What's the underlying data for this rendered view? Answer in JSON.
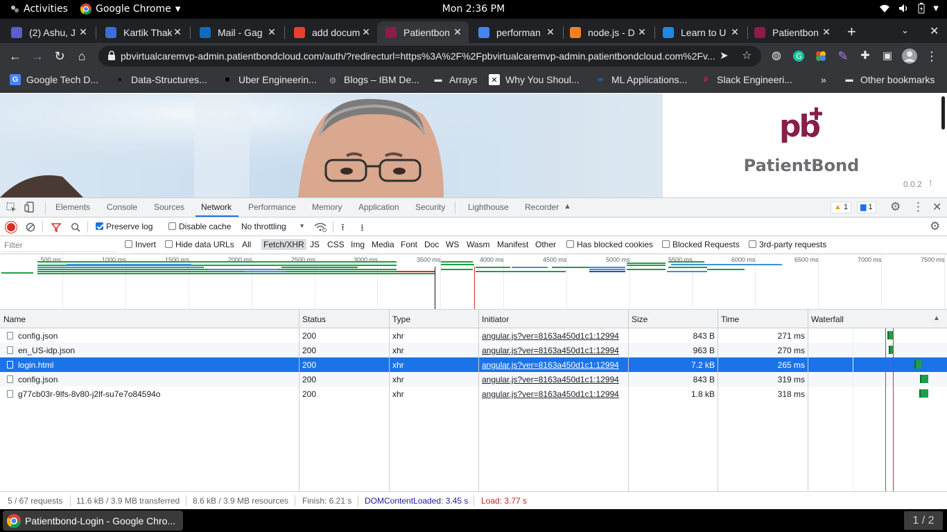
{
  "topbar": {
    "activities": "Activities",
    "app_name": "Google Chrome",
    "clock": "Mon  2:36 PM"
  },
  "tabs": [
    {
      "title": "(2) Ashu, J",
      "icon": "teams-icon",
      "color": "#5b5fc7"
    },
    {
      "title": "Kartik Thak",
      "icon": "app-icon",
      "color": "#3b6fd8"
    },
    {
      "title": "Mail - Gag",
      "icon": "outlook-icon",
      "color": "#0f6cbd"
    },
    {
      "title": "add docum",
      "icon": "gitlab-icon",
      "color": "#e24329"
    },
    {
      "title": "Patientbon",
      "icon": "pb-icon",
      "color": "#8a1d4a",
      "active": true
    },
    {
      "title": "performan",
      "icon": "google-icon",
      "color": "#4285f4"
    },
    {
      "title": "node.js - D",
      "icon": "stackoverflow-icon",
      "color": "#f48024"
    },
    {
      "title": "Learn to U",
      "icon": "app-icon",
      "color": "#1e88e5"
    },
    {
      "title": "Patientbon",
      "icon": "pb-icon",
      "color": "#8a1d4a"
    }
  ],
  "toolbar": {
    "url": "pbvirtualcaremvp-admin.patientbondcloud.com/auth/?redirecturl=https%3A%2F%2Fpbvirtualcaremvp-admin.patientbondcloud.com%2Fv..."
  },
  "bookmarks": [
    {
      "label": "Google Tech D...",
      "icon": "google-icon"
    },
    {
      "label": "Data-Structures...",
      "icon": "github-icon"
    },
    {
      "label": "Uber Engineerin...",
      "icon": "uber-icon"
    },
    {
      "label": "Blogs – IBM De...",
      "icon": "globe-icon"
    },
    {
      "label": "Arrays",
      "icon": "folder-icon"
    },
    {
      "label": "Why You Shoul...",
      "icon": "site-icon"
    },
    {
      "label": "ML Applications...",
      "icon": "meta-icon"
    },
    {
      "label": "Slack Engineeri...",
      "icon": "slack-icon"
    },
    {
      "label": "»",
      "icon": "chevron-icon"
    },
    {
      "label": "Other bookmarks",
      "icon": "folder-icon"
    }
  ],
  "page": {
    "logo_mark": "pb",
    "brand_name": "PatientBond",
    "version": "0.0.2"
  },
  "devtools": {
    "tabs": [
      "Elements",
      "Console",
      "Sources",
      "Network",
      "Performance",
      "Memory",
      "Application",
      "Security",
      "Lighthouse",
      "Recorder"
    ],
    "selected_tab": "Network",
    "warnings": "1",
    "messages": "1",
    "preserve_log": "Preserve log",
    "disable_cache": "Disable cache",
    "throttling": "No throttling",
    "filter_placeholder": "Filter",
    "invert": "Invert",
    "hide_data_urls": "Hide data URLs",
    "type_filters": [
      "All",
      "Fetch/XHR",
      "JS",
      "CSS",
      "Img",
      "Media",
      "Font",
      "Doc",
      "WS",
      "Wasm",
      "Manifest",
      "Other"
    ],
    "selected_type": "Fetch/XHR",
    "has_blocked_cookies": "Has blocked cookies",
    "blocked_requests": "Blocked Requests",
    "third_party": "3rd-party requests",
    "timeline_ticks": [
      "500 ms",
      "1000 ms",
      "1500 ms",
      "2000 ms",
      "2500 ms",
      "3000 ms",
      "3500 ms",
      "4000 ms",
      "4500 ms",
      "5000 ms",
      "5500 ms",
      "6000 ms",
      "6500 ms",
      "7000 ms",
      "7500 ms"
    ],
    "columns": [
      "Name",
      "Status",
      "Type",
      "Initiator",
      "Size",
      "Time",
      "Waterfall"
    ],
    "rows": [
      {
        "name": "config.json",
        "status": "200",
        "type": "xhr",
        "initiator": "angular.js?ver=8163a450d1c1:12994",
        "size": "843 B",
        "time": "271 ms"
      },
      {
        "name": "en_US-idp.json",
        "status": "200",
        "type": "xhr",
        "initiator": "angular.js?ver=8163a450d1c1:12994",
        "size": "963 B",
        "time": "270 ms"
      },
      {
        "name": "login.html",
        "status": "200",
        "type": "xhr",
        "initiator": "angular.js?ver=8163a450d1c1:12994",
        "size": "7.2 kB",
        "time": "265 ms",
        "selected": true
      },
      {
        "name": "config.json",
        "status": "200",
        "type": "xhr",
        "initiator": "angular.js?ver=8163a450d1c1:12994",
        "size": "843 B",
        "time": "319 ms"
      },
      {
        "name": "g77cb03r-9lfs-8v80-j2lf-su7e7o84594o",
        "status": "200",
        "type": "xhr",
        "initiator": "angular.js?ver=8163a450d1c1:12994",
        "size": "1.8 kB",
        "time": "318 ms"
      }
    ],
    "status_bar": {
      "requests": "5 / 67 requests",
      "transferred": "11.6 kB / 3.9 MB transferred",
      "resources": "8.6 kB / 3.9 MB resources",
      "finish": "Finish: 6.21 s",
      "dom": "DOMContentLoaded: 3.45 s",
      "load": "Load: 3.77 s"
    }
  },
  "taskbar": {
    "window_title": "Patientbond-Login - Google Chro...",
    "workspace": "1 / 2"
  }
}
